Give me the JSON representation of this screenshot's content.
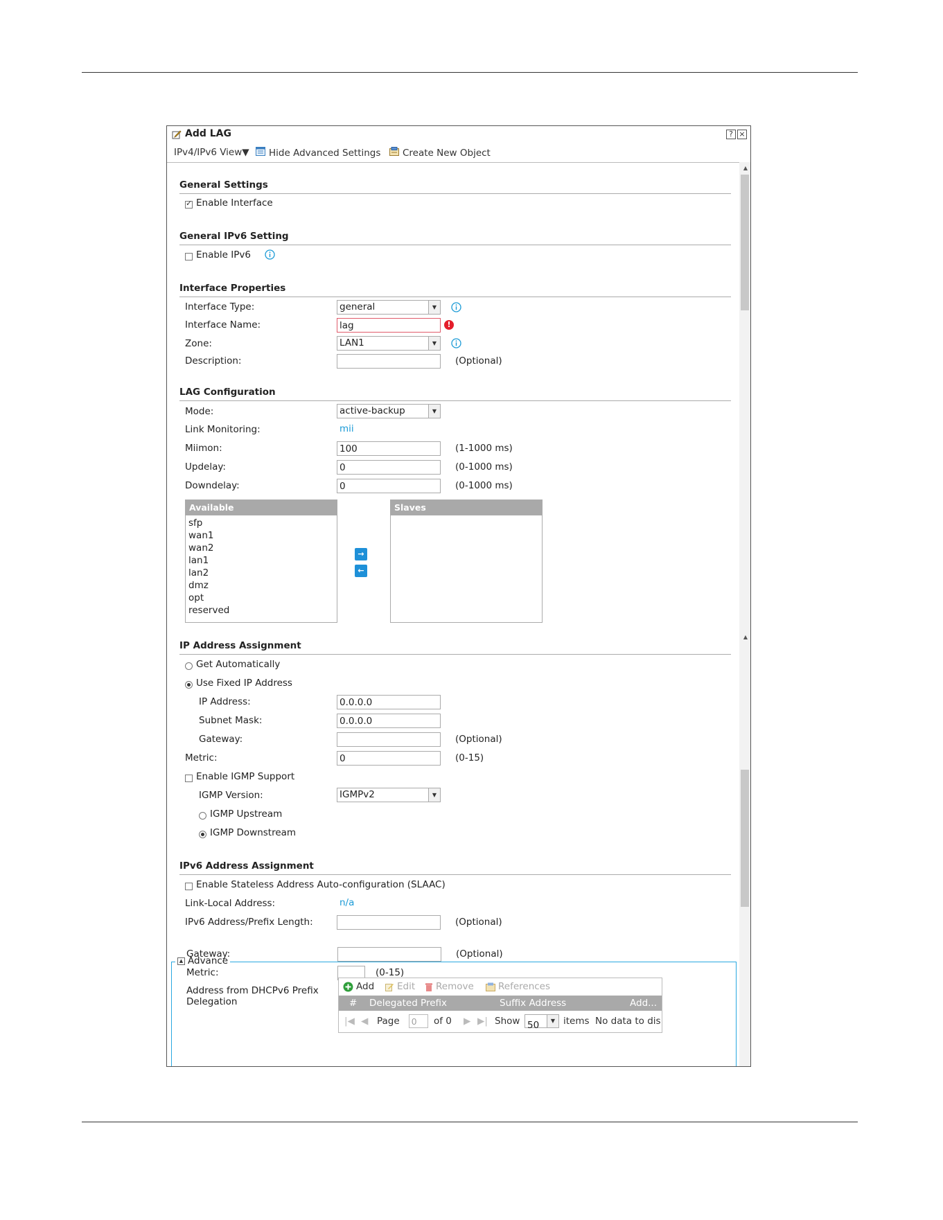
{
  "dialog": {
    "title": "Add LAG",
    "help_btn": "?",
    "close_btn": "×"
  },
  "toolbar": {
    "view": "IPv4/IPv6 View▼",
    "hide_advanced": "Hide Advanced Settings",
    "create_object": "Create New Object"
  },
  "general_settings": {
    "title": "General Settings",
    "enable_interface": "Enable Interface"
  },
  "ipv6_setting": {
    "title": "General IPv6 Setting",
    "enable_ipv6": "Enable IPv6"
  },
  "interface_properties": {
    "title": "Interface Properties",
    "type_label": "Interface Type:",
    "type_value": "general",
    "name_label": "Interface Name:",
    "name_value": "lag",
    "zone_label": "Zone:",
    "zone_value": "LAN1",
    "desc_label": "Description:",
    "desc_value": "",
    "desc_hint": "(Optional)"
  },
  "lag_config": {
    "title": "LAG Configuration",
    "mode_label": "Mode:",
    "mode_value": "active-backup",
    "link_mon_label": "Link Monitoring:",
    "link_mon_value": "mii",
    "miimon_label": "Miimon:",
    "miimon_value": "100",
    "miimon_hint": "(1-1000 ms)",
    "updelay_label": "Updelay:",
    "updelay_value": "0",
    "updelay_hint": "(0-1000 ms)",
    "downdelay_label": "Downdelay:",
    "downdelay_value": "0",
    "downdelay_hint": "(0-1000 ms)",
    "available_header": "Available",
    "available": [
      "sfp",
      "wan1",
      "wan2",
      "lan1",
      "lan2",
      "dmz",
      "opt",
      "reserved"
    ],
    "slaves_header": "Slaves",
    "move_right": "→",
    "move_left": "←"
  },
  "ip_assign": {
    "title": "IP Address Assignment",
    "get_auto": "Get Automatically",
    "use_fixed": "Use Fixed IP Address",
    "ip_label": "IP Address:",
    "ip_value": "0.0.0.0",
    "mask_label": "Subnet Mask:",
    "mask_value": "0.0.0.0",
    "gw_label": "Gateway:",
    "gw_value": "",
    "gw_hint": "(Optional)",
    "metric_label": "Metric:",
    "metric_value": "0",
    "metric_hint": "(0-15)",
    "igmp_enable": "Enable IGMP Support",
    "igmp_ver_label": "IGMP Version:",
    "igmp_ver_value": "IGMPv2",
    "igmp_up": "IGMP Upstream",
    "igmp_down": "IGMP Downstream"
  },
  "ipv6_assign": {
    "title": "IPv6 Address Assignment",
    "slaac": "Enable Stateless Address Auto-configuration (SLAAC)",
    "link_local_label": "Link-Local Address:",
    "link_local_value": "n/a",
    "prefix_label": "IPv6 Address/Prefix Length:",
    "prefix_value": "",
    "prefix_hint": "(Optional)"
  },
  "advance": {
    "legend": "Advance",
    "gw_label": "Gateway:",
    "gw_value": "",
    "gw_hint": "(Optional)",
    "metric_label": "Metric:",
    "metric_value": "",
    "metric_hint": "(0-15)",
    "dhcp_label_1": "Address from DHCPv6 Prefix",
    "dhcp_label_2": "Delegation",
    "grid": {
      "add": "Add",
      "edit": "Edit",
      "remove": "Remove",
      "references": "References",
      "columns": [
        "#",
        "Delegated Prefix",
        "Suffix Address",
        "Add..."
      ],
      "page_label": "Page",
      "page_value": "0",
      "of_label": "of 0",
      "show_label": "Show",
      "show_value": "50",
      "items_label": "items",
      "no_data": "No data to dis"
    }
  },
  "colors": {
    "accent": "#1a9ad6",
    "error": "#e41e2b",
    "header_gray": "#a9a9a9",
    "advance_border": "#29a8e0"
  }
}
